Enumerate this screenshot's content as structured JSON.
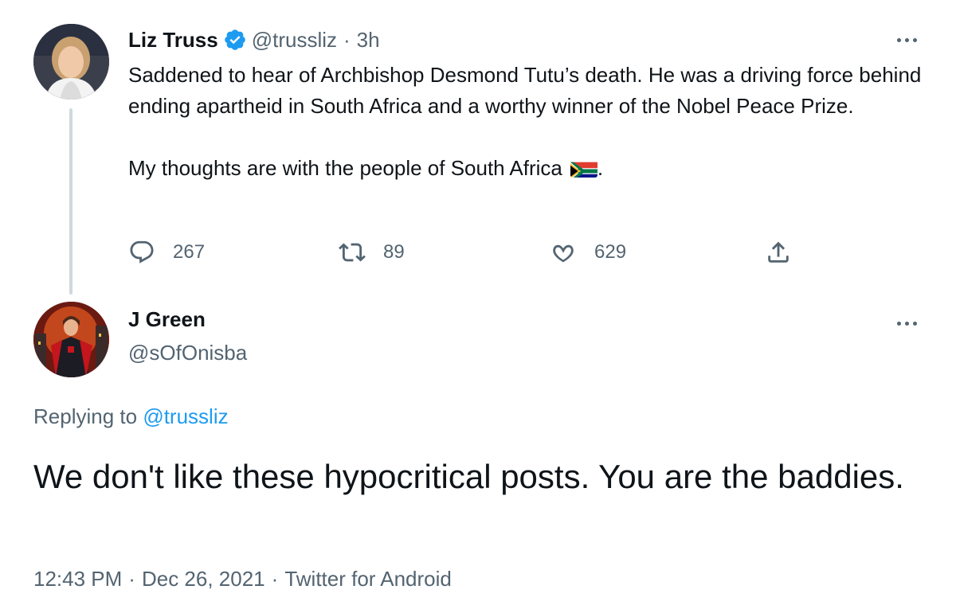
{
  "parent_tweet": {
    "display_name": "Liz Truss",
    "verified": true,
    "handle": "@trussliz",
    "separator": "·",
    "time": "3h",
    "paragraphs": [
      "Saddened to hear of Archbishop Desmond Tutu’s death. He was a driving force behind ending apartheid in South Africa and a worthy winner of the Nobel Peace Prize.",
      "My thoughts are with the people of South Africa"
    ],
    "paragraph_tail": ".",
    "flag_icon": "south-africa-flag",
    "actions": {
      "reply_count": "267",
      "retweet_count": "89",
      "like_count": "629"
    }
  },
  "reply_tweet": {
    "display_name": "J Green",
    "handle": "@sOfOnisba",
    "replying_prefix": "Replying to",
    "replying_handle": "@trussliz",
    "text": "We don't like these hypocritical posts. You are the baddies.",
    "meta": {
      "time": "12:43 PM",
      "separator": "·",
      "date": "Dec 26, 2021",
      "source": "Twitter for Android"
    }
  },
  "colors": {
    "text_primary": "#0f1419",
    "text_secondary": "#536471",
    "accent": "#1d9bf0",
    "thread_line": "#cfd9de"
  },
  "icons": {
    "verified": "verified-badge-icon",
    "more": "more-dots-icon",
    "reply": "reply-bubble-icon",
    "retweet": "retweet-icon",
    "like": "heart-icon",
    "share": "share-icon"
  }
}
